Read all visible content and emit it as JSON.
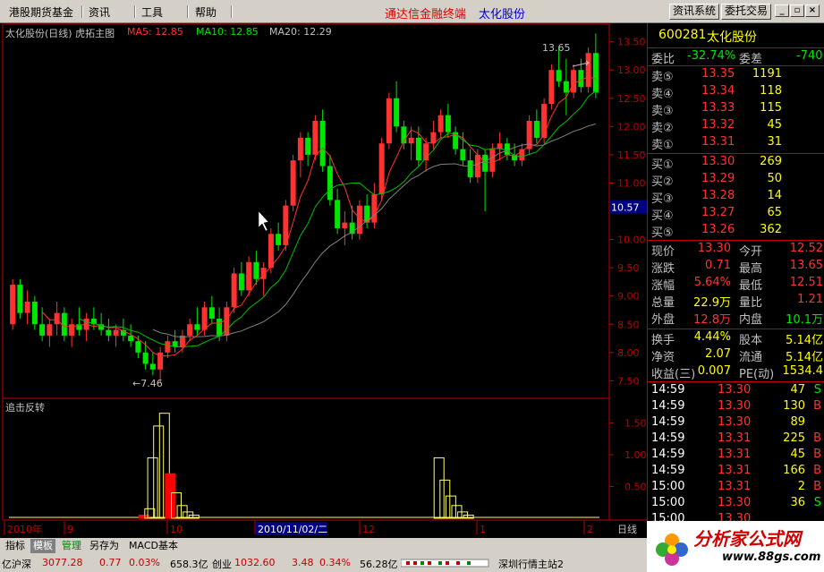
{
  "menu": {
    "items": [
      "港股期货基金",
      "资讯",
      "工具",
      "帮助"
    ],
    "app_title": "通达信金融终端",
    "app_stock": "太化股份",
    "btn_news": "资讯系统",
    "btn_trade": "委托交易"
  },
  "chart_header": {
    "title": "太化股份(日线) 虎拓主图",
    "ma5": "MA5: 12.85",
    "ma10": "MA10: 12.85",
    "ma20": "MA20: 12.29",
    "high_label": "13.65",
    "low_label": "7.46"
  },
  "indicator": {
    "name": "追击反转"
  },
  "y_axis_price": [
    "13.50",
    "13.00",
    "12.50",
    "12.00",
    "11.50",
    "11.00",
    "10.57",
    "10.00",
    "9.50",
    "9.00",
    "8.50",
    "8.00",
    "7.50"
  ],
  "y_axis_ind": [
    "1.50",
    "1.00",
    "0.50"
  ],
  "x_axis": {
    "labels": [
      "2010年",
      "9",
      "10",
      "2010/11/02/二",
      "12",
      "1",
      "2"
    ],
    "unit": "日线"
  },
  "colors": {
    "up": "#ff3232",
    "down": "#00e600",
    "bg": "#000000",
    "frame": "#c00000"
  },
  "chart_data": {
    "type": "candlestick",
    "title": "太化股份(日线)",
    "ylim": [
      7.3,
      13.7
    ],
    "annotations": {
      "high": 13.65,
      "low": 7.46
    },
    "candles": [
      [
        8.5,
        9.3,
        8.4,
        9.2
      ],
      [
        9.2,
        9.3,
        8.6,
        8.7
      ],
      [
        8.7,
        9.1,
        8.5,
        8.9
      ],
      [
        8.9,
        9.0,
        8.4,
        8.5
      ],
      [
        8.5,
        8.8,
        8.2,
        8.3
      ],
      [
        8.3,
        8.6,
        8.1,
        8.5
      ],
      [
        8.5,
        8.9,
        8.3,
        8.7
      ],
      [
        8.7,
        8.8,
        8.2,
        8.3
      ],
      [
        8.3,
        8.6,
        8.1,
        8.5
      ],
      [
        8.5,
        8.8,
        8.3,
        8.4
      ],
      [
        8.4,
        8.7,
        8.2,
        8.6
      ],
      [
        8.6,
        8.8,
        8.4,
        8.5
      ],
      [
        8.5,
        8.7,
        8.3,
        8.4
      ],
      [
        8.4,
        8.6,
        8.2,
        8.3
      ],
      [
        8.3,
        8.5,
        8.1,
        8.4
      ],
      [
        8.4,
        8.6,
        8.2,
        8.3
      ],
      [
        8.3,
        8.5,
        8.1,
        8.2
      ],
      [
        8.2,
        8.3,
        7.9,
        8.0
      ],
      [
        8.0,
        8.2,
        7.7,
        7.8
      ],
      [
        7.8,
        8.0,
        7.6,
        7.7
      ],
      [
        7.7,
        8.1,
        7.46,
        8.0
      ],
      [
        8.0,
        8.3,
        7.9,
        8.2
      ],
      [
        8.2,
        8.4,
        8.0,
        8.1
      ],
      [
        8.1,
        8.4,
        8.0,
        8.3
      ],
      [
        8.3,
        8.6,
        8.2,
        8.5
      ],
      [
        8.5,
        8.8,
        8.3,
        8.4
      ],
      [
        8.4,
        8.9,
        8.3,
        8.8
      ],
      [
        8.8,
        9.0,
        8.5,
        8.6
      ],
      [
        8.6,
        8.8,
        8.2,
        8.3
      ],
      [
        8.3,
        8.9,
        8.2,
        8.8
      ],
      [
        8.8,
        9.5,
        8.7,
        9.4
      ],
      [
        9.4,
        9.6,
        9.0,
        9.1
      ],
      [
        9.1,
        9.7,
        9.0,
        9.6
      ],
      [
        9.6,
        9.8,
        9.2,
        9.3
      ],
      [
        9.3,
        9.6,
        9.0,
        9.5
      ],
      [
        9.5,
        10.2,
        9.4,
        10.1
      ],
      [
        10.1,
        10.3,
        9.8,
        9.9
      ],
      [
        9.9,
        10.7,
        9.8,
        10.6
      ],
      [
        10.6,
        11.5,
        10.5,
        11.4
      ],
      [
        11.4,
        11.9,
        11.1,
        11.8
      ],
      [
        11.8,
        11.9,
        11.3,
        11.5
      ],
      [
        11.5,
        12.2,
        11.4,
        12.1
      ],
      [
        12.1,
        12.3,
        11.2,
        11.3
      ],
      [
        11.3,
        11.5,
        10.6,
        10.7
      ],
      [
        10.7,
        10.9,
        10.1,
        10.2
      ],
      [
        10.2,
        10.5,
        9.9,
        10.3
      ],
      [
        10.3,
        10.6,
        10.0,
        10.1
      ],
      [
        10.1,
        10.7,
        10.0,
        10.6
      ],
      [
        10.6,
        10.8,
        10.2,
        10.3
      ],
      [
        10.3,
        11.0,
        10.2,
        10.8
      ],
      [
        10.8,
        11.8,
        10.7,
        11.7
      ],
      [
        11.7,
        12.6,
        11.6,
        12.5
      ],
      [
        12.5,
        12.8,
        11.9,
        12.0
      ],
      [
        12.0,
        12.1,
        11.6,
        11.7
      ],
      [
        11.7,
        12.0,
        11.4,
        11.8
      ],
      [
        11.8,
        12.0,
        11.3,
        11.4
      ],
      [
        11.4,
        11.8,
        11.2,
        11.7
      ],
      [
        11.7,
        12.1,
        11.6,
        11.9
      ],
      [
        11.9,
        12.3,
        11.8,
        12.2
      ],
      [
        12.2,
        12.4,
        11.8,
        11.9
      ],
      [
        11.9,
        12.0,
        11.5,
        11.6
      ],
      [
        11.6,
        11.9,
        11.3,
        11.4
      ],
      [
        11.4,
        11.6,
        11.0,
        11.1
      ],
      [
        11.1,
        11.6,
        11.0,
        11.5
      ],
      [
        11.5,
        11.6,
        10.5,
        11.2
      ],
      [
        11.2,
        11.7,
        11.1,
        11.6
      ],
      [
        11.6,
        11.9,
        11.4,
        11.7
      ],
      [
        11.7,
        11.8,
        11.4,
        11.5
      ],
      [
        11.5,
        11.7,
        11.3,
        11.4
      ],
      [
        11.4,
        11.7,
        11.3,
        11.6
      ],
      [
        11.6,
        12.2,
        11.5,
        12.1
      ],
      [
        12.1,
        12.3,
        11.7,
        11.8
      ],
      [
        11.8,
        12.5,
        11.7,
        12.4
      ],
      [
        12.4,
        13.1,
        12.3,
        13.0
      ],
      [
        13.0,
        13.4,
        12.7,
        12.8
      ],
      [
        12.8,
        13.2,
        12.2,
        12.6
      ],
      [
        12.6,
        13.1,
        12.5,
        13.0
      ],
      [
        13.0,
        13.2,
        12.6,
        12.7
      ],
      [
        12.7,
        13.4,
        12.6,
        13.3
      ],
      [
        13.3,
        13.65,
        12.5,
        12.6
      ]
    ],
    "indicator_values": [
      0,
      0,
      0,
      0,
      0,
      0,
      0,
      0,
      0,
      0,
      0,
      0,
      0,
      0,
      0,
      0,
      0,
      0,
      0,
      0,
      0,
      0,
      0,
      0,
      0,
      0,
      0,
      0,
      0,
      0,
      0,
      0,
      0,
      0,
      0,
      0,
      0,
      0,
      0,
      0,
      0,
      0,
      0,
      0,
      0,
      0,
      0,
      0,
      0,
      0,
      0,
      0,
      0,
      0,
      0,
      0,
      0,
      0,
      0,
      0,
      0,
      0,
      0,
      0,
      0,
      0,
      0,
      0,
      0,
      0,
      0,
      0,
      0,
      0,
      0,
      0,
      0,
      0,
      0,
      0
    ],
    "indicator_bars": [
      {
        "pos": 0.22,
        "v": 0.05,
        "filled": true
      },
      {
        "pos": 0.23,
        "v": 0.15,
        "filled": false
      },
      {
        "pos": 0.235,
        "v": 0.95,
        "filled": false
      },
      {
        "pos": 0.245,
        "v": 1.45,
        "filled": false
      },
      {
        "pos": 0.255,
        "v": 1.65,
        "filled": false
      },
      {
        "pos": 0.265,
        "v": 0.7,
        "filled": true
      },
      {
        "pos": 0.275,
        "v": 0.4,
        "filled": false
      },
      {
        "pos": 0.285,
        "v": 0.2,
        "filled": false
      },
      {
        "pos": 0.295,
        "v": 0.1,
        "filled": false
      },
      {
        "pos": 0.305,
        "v": 0.05,
        "filled": false
      },
      {
        "pos": 0.72,
        "v": 0.95,
        "filled": false
      },
      {
        "pos": 0.73,
        "v": 0.6,
        "filled": false
      },
      {
        "pos": 0.74,
        "v": 0.35,
        "filled": false
      },
      {
        "pos": 0.75,
        "v": 0.2,
        "filled": false
      },
      {
        "pos": 0.76,
        "v": 0.1,
        "filled": false
      },
      {
        "pos": 0.77,
        "v": 0.05,
        "filled": false
      }
    ],
    "ind_ylim": [
      0,
      1.8
    ]
  },
  "quote": {
    "code": "600281",
    "name": "太化股份",
    "wb_label": "委比",
    "wb_val": "-32.74%",
    "wc_label": "委差",
    "wc_val": "-740",
    "sell": [
      {
        "label": "卖⑤",
        "price": "13.35",
        "vol": "1191"
      },
      {
        "label": "卖④",
        "price": "13.34",
        "vol": "118"
      },
      {
        "label": "卖③",
        "price": "13.33",
        "vol": "115"
      },
      {
        "label": "卖②",
        "price": "13.32",
        "vol": "45"
      },
      {
        "label": "卖①",
        "price": "13.31",
        "vol": "31"
      }
    ],
    "buy": [
      {
        "label": "买①",
        "price": "13.30",
        "vol": "269"
      },
      {
        "label": "买②",
        "price": "13.29",
        "vol": "50"
      },
      {
        "label": "买③",
        "price": "13.28",
        "vol": "14"
      },
      {
        "label": "买④",
        "price": "13.27",
        "vol": "65"
      },
      {
        "label": "买⑤",
        "price": "13.26",
        "vol": "362"
      }
    ],
    "stats": [
      {
        "l1": "现价",
        "v1": "13.30",
        "l2": "今开",
        "v2": "12.52"
      },
      {
        "l1": "涨跌",
        "v1": "0.71",
        "l2": "最高",
        "v2": "13.65"
      },
      {
        "l1": "涨幅",
        "v1": "5.64%",
        "l2": "最低",
        "v2": "12.51"
      },
      {
        "l1": "总量",
        "v1": "22.9万",
        "l2": "量比",
        "v2": "1.21"
      },
      {
        "l1": "外盘",
        "v1": "12.8万",
        "l2": "内盘",
        "v2": "10.1万"
      }
    ],
    "fund": [
      {
        "l1": "换手",
        "v1": "4.44%",
        "l2": "股本",
        "v2": "5.14亿"
      },
      {
        "l1": "净资",
        "v1": "2.07",
        "l2": "流通",
        "v2": "5.14亿"
      },
      {
        "l1": "收益(三)",
        "v1": "0.007",
        "l2": "PE(动)",
        "v2": "1534.4"
      }
    ],
    "ticks": [
      {
        "t": "14:59",
        "p": "13.30",
        "v": "47",
        "s": "S"
      },
      {
        "t": "14:59",
        "p": "13.30",
        "v": "130",
        "s": "B"
      },
      {
        "t": "14:59",
        "p": "13.30",
        "v": "89",
        "s": ""
      },
      {
        "t": "14:59",
        "p": "13.31",
        "v": "225",
        "s": "B"
      },
      {
        "t": "14:59",
        "p": "13.31",
        "v": "45",
        "s": "B"
      },
      {
        "t": "14:59",
        "p": "13.31",
        "v": "166",
        "s": "B"
      },
      {
        "t": "15:00",
        "p": "13.31",
        "v": "2",
        "s": "B"
      },
      {
        "t": "15:00",
        "p": "13.30",
        "v": "36",
        "s": "S"
      },
      {
        "t": "15:00",
        "p": "13.30",
        "v": "",
        "s": ""
      }
    ]
  },
  "tabs": [
    "指标",
    "模板",
    "管理",
    "另存为",
    "MACD基本"
  ],
  "status": {
    "sh_label": "亿沪深",
    "sh_index": "3077.28",
    "sh_chg": "0.77",
    "sh_pct": "0.03%",
    "sh_amt": "658.3亿",
    "cy_label": "创业",
    "cy_index": "1032.60",
    "cy_chg": "3.48",
    "cy_pct": "0.34%",
    "cy_amt": "56.28亿",
    "station": "深圳行情主站2"
  },
  "logo": {
    "text": "分析家公式网",
    "url": "www.88gs.com"
  }
}
